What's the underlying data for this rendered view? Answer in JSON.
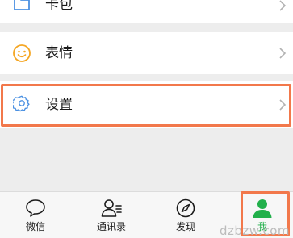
{
  "menu": {
    "items": [
      {
        "label": "卡包",
        "icon": "cardpack-icon",
        "icon_color": "#4a90e2"
      },
      {
        "label": "表情",
        "icon": "sticker-smiley-icon",
        "icon_color": "#f5a623"
      },
      {
        "label": "设置",
        "icon": "settings-gear-icon",
        "icon_color": "#4a90e2",
        "highlighted": true
      }
    ]
  },
  "tabbar": {
    "tabs": [
      {
        "label": "微信",
        "icon": "chat-bubble-icon",
        "active": false
      },
      {
        "label": "通讯录",
        "icon": "contacts-icon",
        "active": false
      },
      {
        "label": "发现",
        "icon": "compass-icon",
        "active": false
      },
      {
        "label": "我",
        "icon": "person-icon",
        "active": true,
        "highlighted": true
      }
    ]
  },
  "colors": {
    "accent_green": "#22b04b",
    "highlight_border": "#f2784b",
    "background": "#ededed"
  },
  "watermark": "dzbzw.com"
}
